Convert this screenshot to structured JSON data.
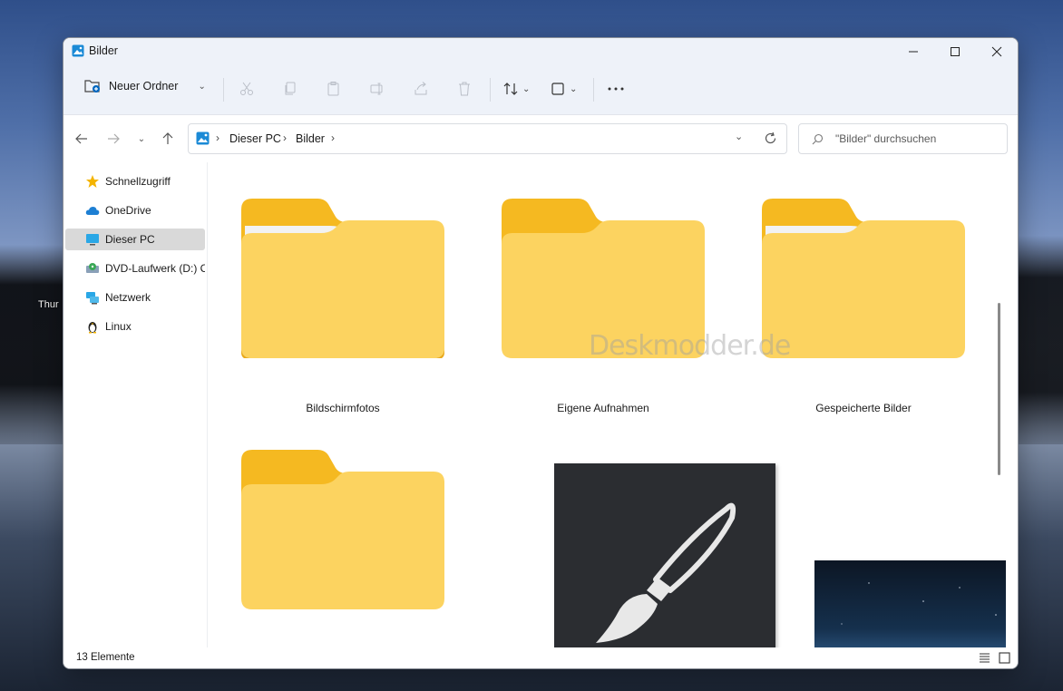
{
  "desktop": {
    "partial_label": "Thur"
  },
  "window": {
    "title": "Bilder"
  },
  "toolbar": {
    "new_folder_label": "Neuer Ordner",
    "icons": [
      "new-folder-icon",
      "cut-icon",
      "copy-icon",
      "paste-icon",
      "rename-icon",
      "share-icon",
      "delete-icon",
      "sort-icon",
      "view-icon",
      "more-icon"
    ]
  },
  "address": {
    "crumbs": [
      "Dieser PC",
      "Bilder"
    ],
    "search_placeholder": "\"Bilder\" durchsuchen"
  },
  "sidebar": {
    "items": [
      {
        "label": "Schnellzugriff",
        "icon": "star-icon"
      },
      {
        "label": "OneDrive",
        "icon": "cloud-icon"
      },
      {
        "label": "Dieser PC",
        "icon": "monitor-icon",
        "selected": true
      },
      {
        "label": "DVD-Laufwerk (D:) C",
        "icon": "dvd-icon"
      },
      {
        "label": "Netzwerk",
        "icon": "network-icon"
      },
      {
        "label": "Linux",
        "icon": "penguin-icon"
      }
    ]
  },
  "content": {
    "items": [
      {
        "label": "Bildschirmfotos",
        "type": "folder"
      },
      {
        "label": "Eigene Aufnahmen",
        "type": "folder"
      },
      {
        "label": "Gespeicherte Bilder",
        "type": "folder"
      },
      {
        "label": "",
        "type": "folder"
      },
      {
        "label": "",
        "type": "image-paint"
      },
      {
        "label": "",
        "type": "image-night-sky"
      }
    ],
    "watermark": "Deskmodder.de"
  },
  "status": {
    "count_text": "13 Elemente"
  },
  "colors": {
    "folder_back": "#f5b921",
    "folder_front": "#fcd360",
    "accent": "#0067c0"
  }
}
